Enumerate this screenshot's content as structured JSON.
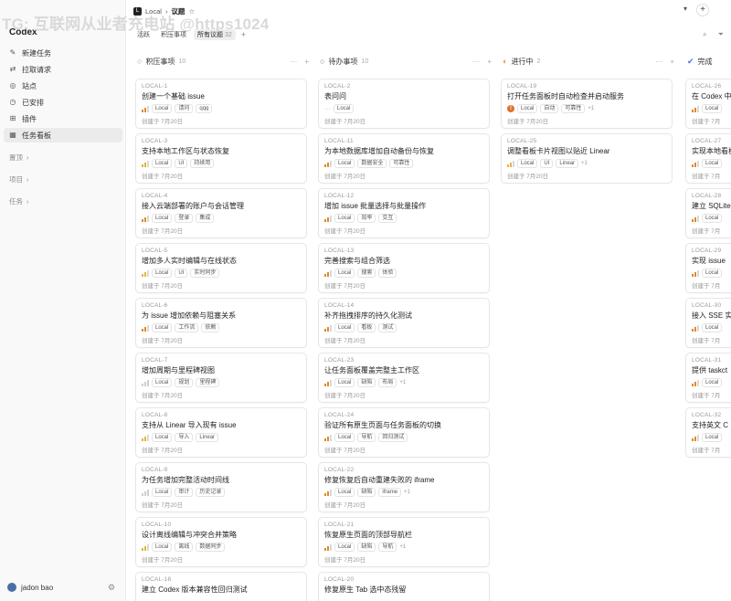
{
  "watermark": "TG: 互联网从业者充电站 @https1024",
  "sidebar": {
    "app_title": "Codex",
    "nav": [
      {
        "label": "新建任务",
        "icon": "edit-icon"
      },
      {
        "label": "拉取请求",
        "icon": "pull-request-icon"
      },
      {
        "label": "站点",
        "icon": "globe-icon"
      },
      {
        "label": "已安排",
        "icon": "clock-icon"
      },
      {
        "label": "插件",
        "icon": "plugin-icon"
      },
      {
        "label": "任务看板",
        "icon": "board-icon",
        "active": true
      }
    ],
    "sections": [
      "置顶",
      "项目",
      "任务"
    ],
    "user": "jadon bao"
  },
  "header": {
    "breadcrumb_source": "Local",
    "breadcrumb_current": "议题",
    "tabs": [
      {
        "label": "活跃"
      },
      {
        "label": "积压事项"
      },
      {
        "label": "所有议题",
        "count": "32",
        "active": true
      }
    ]
  },
  "columns": [
    {
      "name": "积压事项",
      "count": "10",
      "icon": "○",
      "cards": [
        {
          "id": "LOCAL-1",
          "title": "创建一个基础 issue",
          "tags": [
            "Local",
            "请问",
            "qqq"
          ],
          "date": "创建于 7月20日",
          "prio": "mid"
        },
        {
          "id": "LOCAL-3",
          "title": "支持本地工作区与状态恢复",
          "tags": [
            "Local",
            "UI",
            "持续用"
          ],
          "date": "创建于 7月20日",
          "prio": "low"
        },
        {
          "id": "LOCAL-4",
          "title": "接入云端部署的账户与会话管理",
          "tags": [
            "Local",
            "登录",
            "集成"
          ],
          "date": "创建于 7月20日",
          "prio": "mid"
        },
        {
          "id": "LOCAL-5",
          "title": "增加多人实时编辑与在线状态",
          "tags": [
            "Local",
            "UI",
            "实时同步"
          ],
          "date": "创建于 7月20日",
          "prio": "low"
        },
        {
          "id": "LOCAL-6",
          "title": "为 issue 增加依赖与阻塞关系",
          "tags": [
            "Local",
            "工作流",
            "依赖"
          ],
          "date": "创建于 7月20日",
          "prio": "mid"
        },
        {
          "id": "LOCAL-7",
          "title": "增加周期与里程碑视图",
          "tags": [
            "Local",
            "规划",
            "里程碑"
          ],
          "date": "创建于 7月20日",
          "prio": "none"
        },
        {
          "id": "LOCAL-8",
          "title": "支持从 Linear 导入现有 issue",
          "tags": [
            "Local",
            "导入",
            "Linear"
          ],
          "date": "创建于 7月20日",
          "prio": "low"
        },
        {
          "id": "LOCAL-9",
          "title": "为任务增加完整活动时间线",
          "tags": [
            "Local",
            "审计",
            "历史记录"
          ],
          "date": "创建于 7月20日",
          "prio": "none"
        },
        {
          "id": "LOCAL-10",
          "title": "设计离线编辑与冲突合并策略",
          "tags": [
            "Local",
            "离线",
            "数据同步"
          ],
          "date": "创建于 7月20日",
          "prio": "low"
        },
        {
          "id": "LOCAL-18",
          "title": "建立 Codex 版本兼容性回归测试",
          "tags": [],
          "date": "",
          "prio": "none"
        }
      ]
    },
    {
      "name": "待办事项",
      "count": "10",
      "icon": "○",
      "cards": [
        {
          "id": "LOCAL-2",
          "title": "表问问",
          "tags": [
            "Local"
          ],
          "date": "创建于 7月20日",
          "prio": "dash"
        },
        {
          "id": "LOCAL-11",
          "title": "为本地数据库增加自动备份与恢复",
          "tags": [
            "Local",
            "数据安全",
            "可靠性"
          ],
          "date": "创建于 7月20日",
          "prio": "mid"
        },
        {
          "id": "LOCAL-12",
          "title": "增加 issue 批量选择与批量操作",
          "tags": [
            "Local",
            "效率",
            "交互"
          ],
          "date": "创建于 7月20日",
          "prio": "mid"
        },
        {
          "id": "LOCAL-13",
          "title": "完善搜索与组合筛选",
          "tags": [
            "Local",
            "搜索",
            "体验"
          ],
          "date": "创建于 7月20日",
          "prio": "mid"
        },
        {
          "id": "LOCAL-14",
          "title": "补齐拖拽排序的持久化测试",
          "tags": [
            "Local",
            "看板",
            "测试"
          ],
          "date": "创建于 7月20日",
          "prio": "mid"
        },
        {
          "id": "LOCAL-23",
          "title": "让任务面板覆盖完整主工作区",
          "tags": [
            "Local",
            "缺陷",
            "布局"
          ],
          "more": "+1",
          "date": "创建于 7月20日",
          "prio": "mid"
        },
        {
          "id": "LOCAL-24",
          "title": "验证所有原生页面与任务面板的切换",
          "tags": [
            "Local",
            "导航",
            "回归测试"
          ],
          "date": "创建于 7月20日",
          "prio": "mid"
        },
        {
          "id": "LOCAL-22",
          "title": "修复恢复后自动重建失败的 iframe",
          "tags": [
            "Local",
            "缺陷",
            "iframe"
          ],
          "more": "+1",
          "date": "创建于 7月20日",
          "prio": "mid"
        },
        {
          "id": "LOCAL-21",
          "title": "恢复原生页面的顶部导航栏",
          "tags": [
            "Local",
            "缺陷",
            "导航"
          ],
          "more": "+1",
          "date": "创建于 7月20日",
          "prio": "mid"
        },
        {
          "id": "LOCAL-20",
          "title": "修复原生 Tab 选中态残留",
          "tags": [],
          "date": "",
          "prio": "none"
        }
      ]
    },
    {
      "name": "进行中",
      "count": "2",
      "icon": "◐",
      "cards": [
        {
          "id": "LOCAL-19",
          "title": "打开任务面板时自动检查并启动服务",
          "tags": [
            "Local",
            "自动",
            "可靠性"
          ],
          "more": "+1",
          "date": "创建于 7月20日",
          "prio": "urgent"
        },
        {
          "id": "LOCAL-25",
          "title": "调整看板卡片视图以贴近 Linear",
          "tags": [
            "Local",
            "UI",
            "Linear"
          ],
          "more": "+1",
          "date": "创建于 7月20日",
          "prio": "low"
        }
      ]
    },
    {
      "name": "完成",
      "count": "",
      "icon": "✔",
      "cards": [
        {
          "id": "LOCAL-26",
          "title": "在 Codex 中",
          "tags": [
            "Local"
          ],
          "date": "创建于 7月",
          "prio": "mid"
        },
        {
          "id": "LOCAL-27",
          "title": "实现本地看板",
          "tags": [
            "Local"
          ],
          "date": "创建于 7月",
          "prio": "mid"
        },
        {
          "id": "LOCAL-28",
          "title": "建立 SQLite",
          "tags": [
            "Local"
          ],
          "date": "创建于 7月",
          "prio": "mid"
        },
        {
          "id": "LOCAL-29",
          "title": "实现 issue",
          "tags": [
            "Local"
          ],
          "date": "创建于 7月",
          "prio": "mid"
        },
        {
          "id": "LOCAL-30",
          "title": "接入 SSE 实",
          "tags": [
            "Local"
          ],
          "date": "创建于 7月",
          "prio": "mid"
        },
        {
          "id": "LOCAL-31",
          "title": "提供 taskct",
          "tags": [
            "Local"
          ],
          "date": "创建于 7月",
          "prio": "mid"
        },
        {
          "id": "LOCAL-32",
          "title": "支持英文 C",
          "tags": [
            "Local"
          ],
          "date": "创建于 7月",
          "prio": "mid"
        }
      ]
    }
  ]
}
